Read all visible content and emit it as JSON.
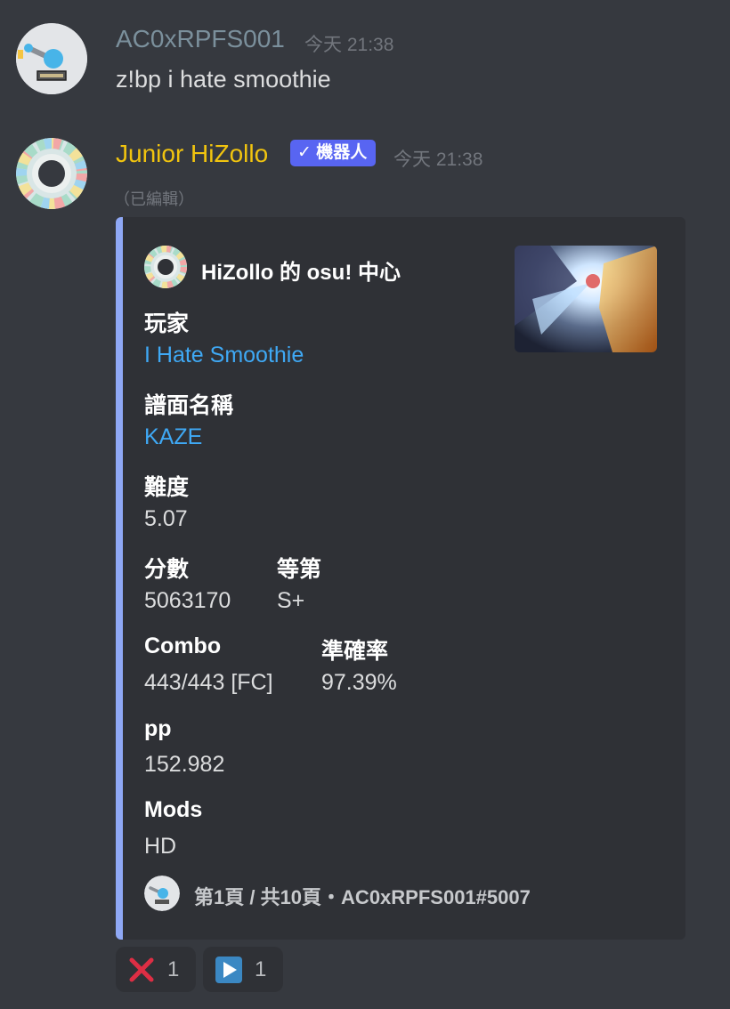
{
  "messages": [
    {
      "username": "AC0xRPFS001",
      "timestamp": "今天 21:38",
      "content": "z!bp i hate smoothie"
    },
    {
      "username": "Junior HiZollo",
      "bot_tag": "機器人",
      "timestamp": "今天 21:38",
      "edited": "（已編輯）"
    }
  ],
  "embed": {
    "author": "HiZollo 的 osu! 中心",
    "fields": {
      "player": {
        "name": "玩家",
        "value": "I Hate Smoothie"
      },
      "beatmap": {
        "name": "譜面名稱",
        "value": "KAZE"
      },
      "difficulty": {
        "name": "難度",
        "value": "5.07"
      },
      "score": {
        "name": "分數",
        "value": "5063170"
      },
      "rank": {
        "name": "等第",
        "value": "S+"
      },
      "combo": {
        "name": "Combo",
        "value": "443/443 [FC]"
      },
      "accuracy": {
        "name": "準確率",
        "value": "97.39%"
      },
      "pp": {
        "name": "pp",
        "value": "152.982"
      },
      "mods": {
        "name": "Mods",
        "value": "HD"
      }
    },
    "footer": "第1頁 / 共10頁・AC0xRPFS001#5007"
  },
  "reactions": [
    {
      "emoji": "cross-mark-icon",
      "count": "1"
    },
    {
      "emoji": "play-button-icon",
      "count": "1"
    }
  ],
  "colors": {
    "background": "#36393f",
    "embed_background": "#2f3136",
    "embed_accent": "#8fa8f5",
    "user1_name": "#7b909c",
    "bot_name": "#f1c40f",
    "link": "#3fa9f5",
    "bot_tag": "#5865f2"
  }
}
